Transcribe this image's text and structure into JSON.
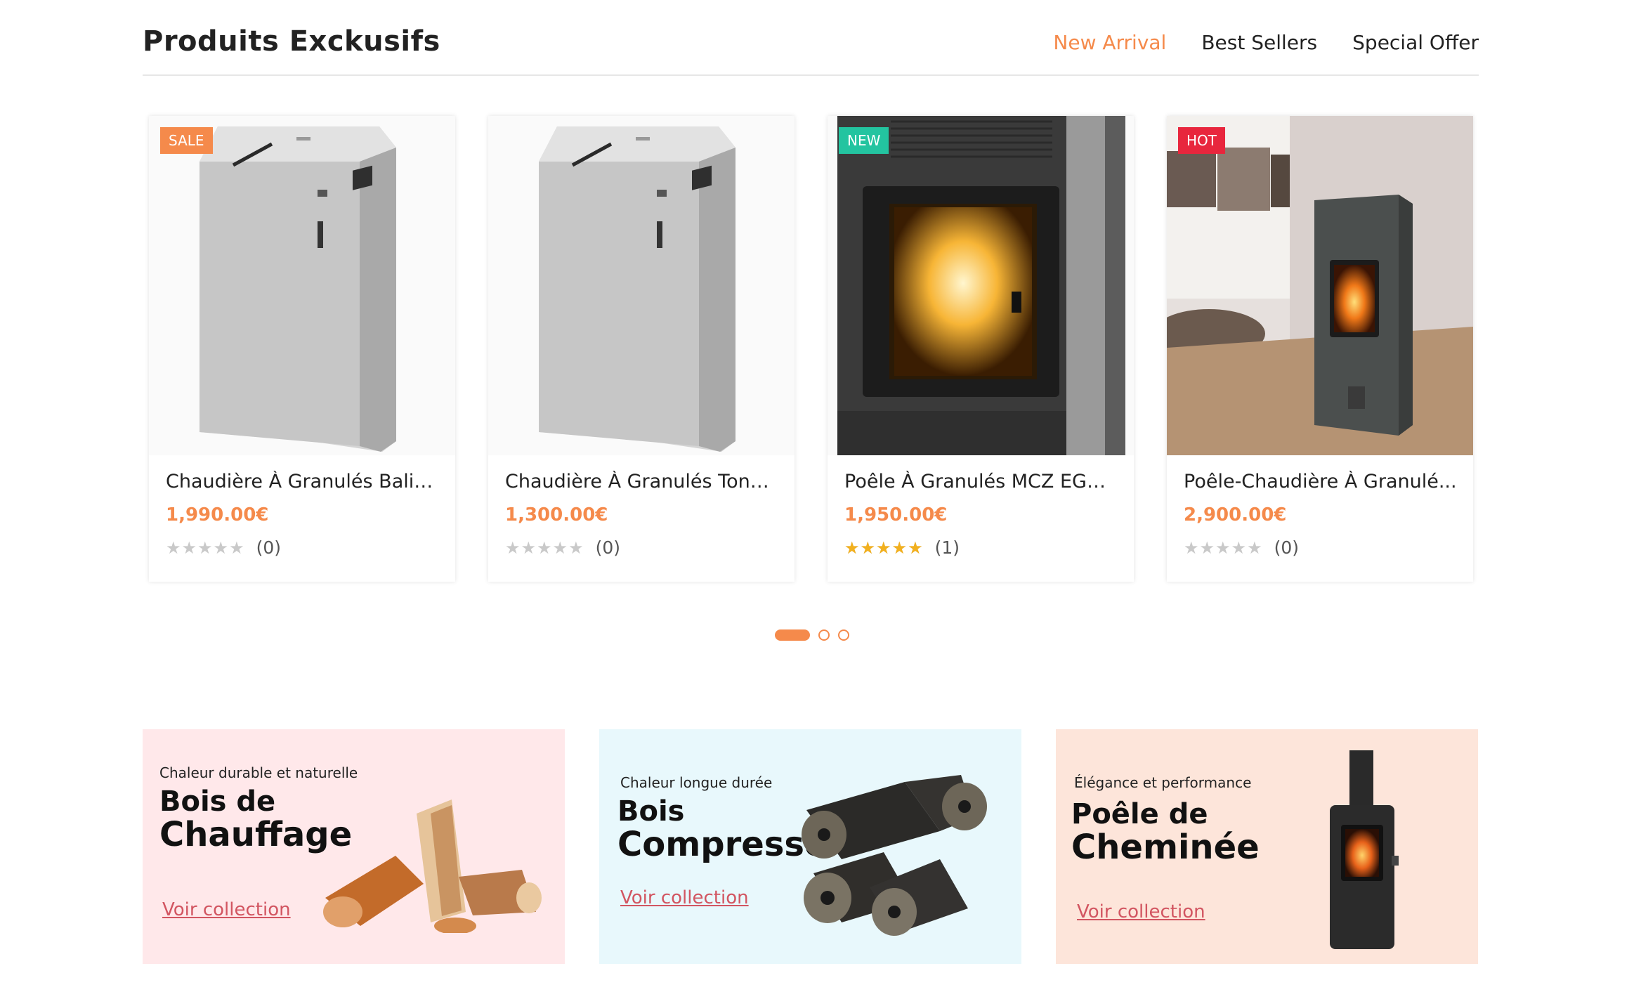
{
  "header": {
    "title": "Produits Exckusifs",
    "tabs": [
      {
        "label": "New Arrival",
        "active": true
      },
      {
        "label": "Best Sellers",
        "active": false
      },
      {
        "label": "Special Offer",
        "active": false
      }
    ]
  },
  "products": [
    {
      "badge": "SALE",
      "badge_color": "#f58a4b",
      "name": "Chaudière À Granulés Baliut...",
      "price": "1,990.00€",
      "rating": 0,
      "review_count": "(0)",
      "image_icon": "pellet-boiler-image"
    },
    {
      "badge": "",
      "badge_color": "",
      "name": "Chaudière À Granulés Tonn...",
      "price": "1,300.00€",
      "rating": 0,
      "review_count": "(0)",
      "image_icon": "pellet-boiler-image"
    },
    {
      "badge": "NEW",
      "badge_color": "#23c4a0",
      "name": "Poêle À Granulés MCZ EGO ...",
      "price": "1,950.00€",
      "rating": 5,
      "review_count": "(1)",
      "image_icon": "pellet-stove-image"
    },
    {
      "badge": "HOT",
      "badge_color": "#e8263d",
      "name": "Poêle-Chaudière À Granulé...",
      "price": "2,900.00€",
      "rating": 0,
      "review_count": "(0)",
      "image_icon": "stove-room-image"
    }
  ],
  "pager": {
    "pages": 3,
    "active": 0
  },
  "banners": [
    {
      "tagline": "Chaleur durable et naturelle",
      "title_line1": "Bois de",
      "title_line2": "Chauffage",
      "link": "Voir collection",
      "bg": "#ffe8ea",
      "image_icon": "firewood-image"
    },
    {
      "tagline": "Chaleur longue durée",
      "title_line1": "Bois",
      "title_line2": "Compressé",
      "link": "Voir collection",
      "bg": "#e8f8fc",
      "image_icon": "compressed-logs-image"
    },
    {
      "tagline": "Élégance et performance",
      "title_line1": "Poêle de",
      "title_line2": "Cheminée",
      "link": "Voir collection",
      "bg": "#fde5da",
      "image_icon": "chimney-stove-image"
    }
  ],
  "colors": {
    "accent": "#f58a4b",
    "link": "#d25561",
    "star": "#f2b01e"
  }
}
